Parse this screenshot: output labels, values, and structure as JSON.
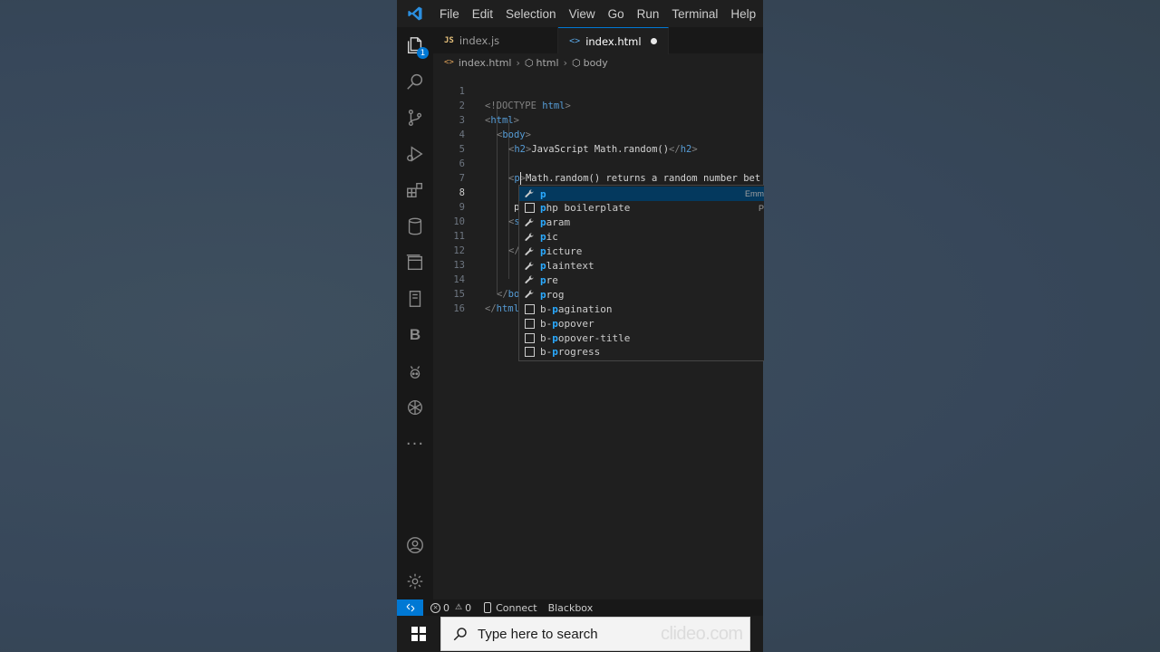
{
  "menu": [
    "File",
    "Edit",
    "Selection",
    "View",
    "Go",
    "Run",
    "Terminal",
    "Help"
  ],
  "explorer_badge": "1",
  "tabs": [
    {
      "icon": "JS",
      "label": "index.js"
    },
    {
      "icon": "<>",
      "label": "index.html"
    }
  ],
  "breadcrumb": {
    "file": "index.html",
    "items": [
      "html",
      "body"
    ]
  },
  "editor": {
    "line_numbers": [
      "1",
      "2",
      "3",
      "4",
      "5",
      "6",
      "7",
      "8",
      "9",
      "10",
      "11",
      "12",
      "13",
      "14",
      "15",
      "16"
    ],
    "lines": {
      "l1": {
        "open": "<!DOCTYPE ",
        "kw": "html",
        "close": ">"
      },
      "l2": {
        "open": "<",
        "tn": "html",
        "close": ">"
      },
      "l3": {
        "open": "<",
        "tn": "body",
        "close": ">"
      },
      "l4": {
        "open": "<",
        "tn": "h2",
        "close": ">",
        "text": "JavaScript Math.random()",
        "etag_open": "</",
        "etn": "h2",
        "etag_close": ">"
      },
      "l6": {
        "open": "<",
        "tn": "p",
        "close": ">",
        "text": "Math.random() returns a random number bet"
      },
      "l8": {
        "text": "p"
      },
      "l9": {
        "open": "<",
        "tn": "s"
      },
      "l11": {
        "open": "</"
      },
      "l14": {
        "open": "</",
        "tn": "bo"
      },
      "l15": {
        "open": "</",
        "tn": "html"
      }
    }
  },
  "suggestions": [
    {
      "icon": "wrench",
      "hl": "p",
      "rest": "",
      "detail": "Emm"
    },
    {
      "icon": "snippet",
      "hl": "p",
      "rest": "hp boilerplate",
      "detail": "P"
    },
    {
      "icon": "wrench",
      "hl": "p",
      "rest": "aram",
      "detail": ""
    },
    {
      "icon": "wrench",
      "hl": "p",
      "rest": "ic",
      "detail": ""
    },
    {
      "icon": "wrench",
      "hl": "p",
      "rest": "icture",
      "detail": ""
    },
    {
      "icon": "wrench",
      "hl": "p",
      "rest": "laintext",
      "detail": ""
    },
    {
      "icon": "wrench",
      "hl": "p",
      "rest": "re",
      "detail": ""
    },
    {
      "icon": "wrench",
      "hl": "p",
      "rest": "rog",
      "detail": ""
    },
    {
      "icon": "snippet",
      "pre": "b-",
      "hl": "p",
      "rest": "agination",
      "detail": ""
    },
    {
      "icon": "snippet",
      "pre": "b-",
      "hl": "p",
      "rest": "opover",
      "detail": ""
    },
    {
      "icon": "snippet",
      "pre": "b-",
      "hl": "p",
      "rest": "opover-title",
      "detail": ""
    },
    {
      "icon": "snippet",
      "pre": "b-",
      "hl": "p",
      "rest": "rogress",
      "detail": ""
    }
  ],
  "status": {
    "errors": "0",
    "warnings": "0",
    "connect": "Connect",
    "extension": "Blackbox"
  },
  "taskbar": {
    "search_placeholder": "Type here to search",
    "watermark": "clideo.com"
  },
  "colors": {
    "accent": "#0078d4",
    "tag": "#569cd6",
    "match": "#2aaaff"
  }
}
